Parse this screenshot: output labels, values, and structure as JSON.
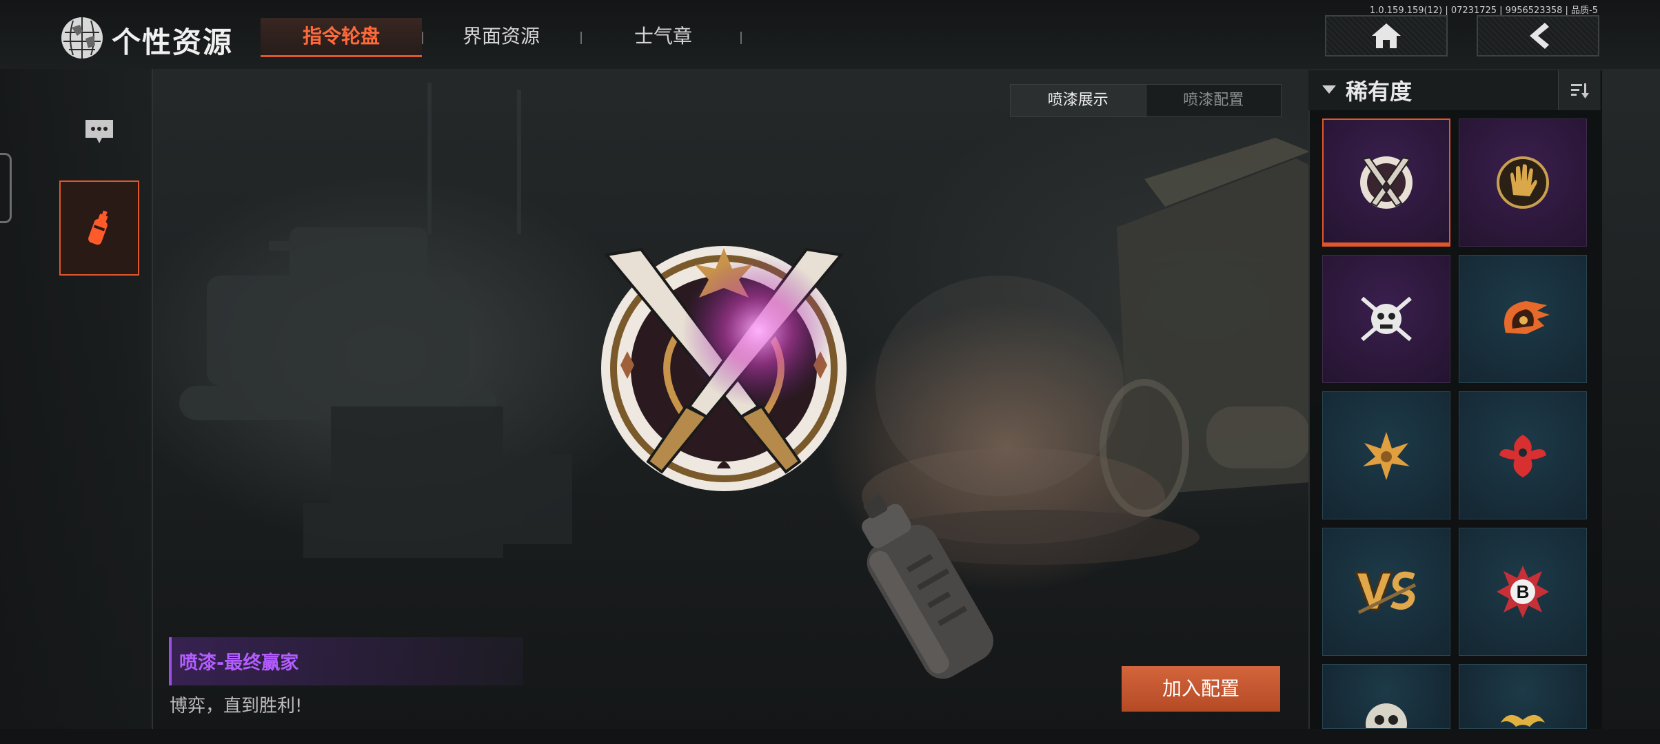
{
  "header": {
    "title": "个性资源",
    "version": "1.0.159.159(12) | 07231725 | 9956523358 | 品质-5",
    "tabs": [
      {
        "label": "指令轮盘",
        "active": true
      },
      {
        "label": "界面资源",
        "active": false
      },
      {
        "label": "士气章",
        "active": false
      }
    ],
    "home_icon": "home-icon",
    "back_icon": "back-arrow-icon"
  },
  "sidebar": {
    "items": [
      {
        "icon": "chat-bubble-icon",
        "active": false
      },
      {
        "icon": "spray-can-icon",
        "active": true
      }
    ]
  },
  "toggle": {
    "show": "喷漆展示",
    "config": "喷漆配置"
  },
  "item": {
    "name": "喷漆-最终赢家",
    "description": "博弈，直到胜利!"
  },
  "actions": {
    "add_config": "加入配置"
  },
  "rarity_panel": {
    "title": "稀有度",
    "sort_icon": "sort-icon",
    "items": [
      {
        "icon": "crossed-knives-emblem-icon",
        "rarity": "purple",
        "selected": true
      },
      {
        "icon": "hand-print-emblem-icon",
        "rarity": "purple",
        "selected": false
      },
      {
        "icon": "bulldog-skull-emblem-icon",
        "rarity": "purple",
        "selected": false
      },
      {
        "icon": "flaming-helmet-emblem-icon",
        "rarity": "blue",
        "selected": false
      },
      {
        "icon": "golden-leaf-emblem-icon",
        "rarity": "blue",
        "selected": false
      },
      {
        "icon": "red-phoenix-emblem-icon",
        "rarity": "blue",
        "selected": false
      },
      {
        "icon": "vs-emblem-icon",
        "rarity": "blue",
        "selected": false
      },
      {
        "icon": "bomb-b-emblem-icon",
        "rarity": "blue",
        "selected": false
      },
      {
        "icon": "skull-badge-emblem-icon",
        "rarity": "blue",
        "selected": false
      },
      {
        "icon": "gold-mustache-emblem-icon",
        "rarity": "blue",
        "selected": false
      }
    ]
  },
  "colors": {
    "accent": "#e0572c",
    "epic_purple": "#b35cff",
    "rare_blue": "#1d3a48"
  }
}
